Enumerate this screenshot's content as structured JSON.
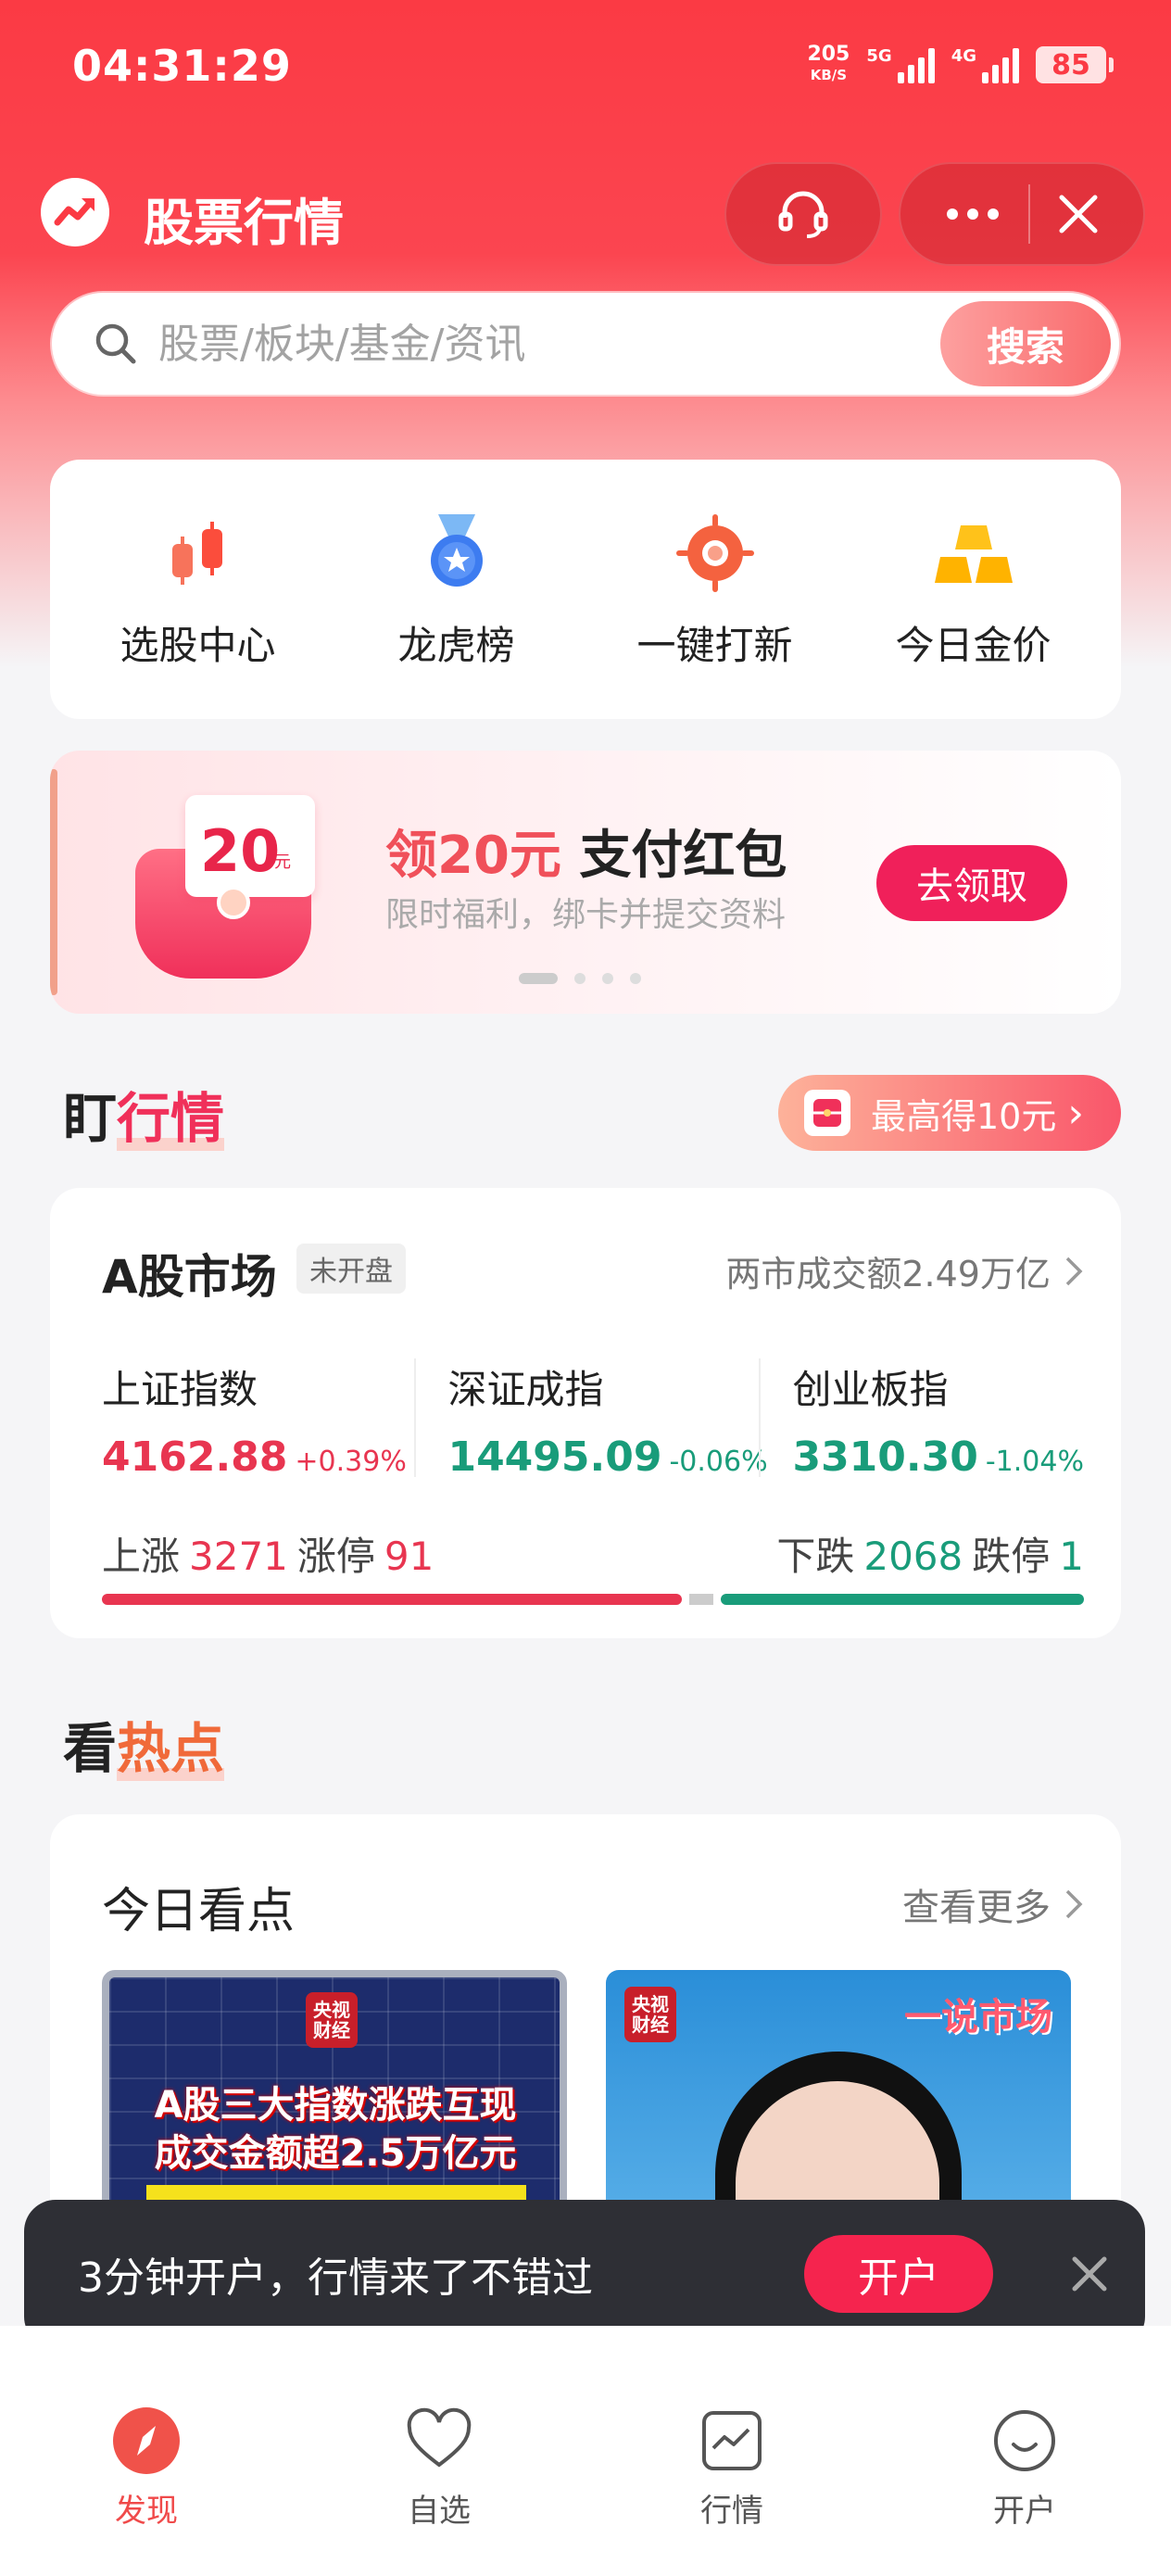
{
  "status_bar": {
    "time": "04:31:29",
    "net_speed_value": "205",
    "net_speed_unit": "KB/S",
    "signal1_label": "5G",
    "signal2_label": "4G",
    "battery": "85"
  },
  "header": {
    "title": "股票行情",
    "support_icon": "headset-icon",
    "more_icon": "more-dots-icon",
    "close_icon": "close-icon"
  },
  "search": {
    "placeholder": "股票/板块/基金/资讯",
    "button": "搜索"
  },
  "quick_links": [
    {
      "label": "选股中心",
      "icon": "candlestick-icon"
    },
    {
      "label": "龙虎榜",
      "icon": "medal-icon"
    },
    {
      "label": "一键打新",
      "icon": "target-icon"
    },
    {
      "label": "今日金价",
      "icon": "gold-bars-icon"
    }
  ],
  "banner": {
    "coupon_amount": "20",
    "coupon_unit": "元",
    "headline_amount": "领20元",
    "headline_rest": " 支付红包",
    "subtitle": "限时福利，绑卡并提交资料",
    "button": "去领取",
    "page_count": 4,
    "active_page": 1
  },
  "market_section": {
    "title_plain": "盯",
    "title_highlight": "行情",
    "reward_label": "最高得10元",
    "reward_chevron": "›"
  },
  "market_card": {
    "title": "A股市场",
    "status_badge": "未开盘",
    "turnover": "两市成交额2.49万亿",
    "indices": [
      {
        "name": "上证指数",
        "value": "4162.88",
        "change": "+0.39%",
        "direction": "up"
      },
      {
        "name": "深证成指",
        "value": "14495.09",
        "change": "-0.06%",
        "direction": "down"
      },
      {
        "name": "创业板指",
        "value": "3310.30",
        "change": "-1.04%",
        "direction": "down"
      }
    ],
    "breadth": {
      "up_label": "上涨",
      "up_count": "3271",
      "limit_up_label": "涨停",
      "limit_up_count": "91",
      "down_label": "下跌",
      "down_count": "2068",
      "limit_down_label": "跌停",
      "limit_down_count": "1"
    },
    "breadth_bar": {
      "up_share": 0.6,
      "flat_share": 0.025,
      "down_share": 0.375
    },
    "colors": {
      "up": "#e83550",
      "down": "#199c7a",
      "flat": "#cccccc"
    }
  },
  "hot_section": {
    "title_plain": "看",
    "title_highlight": "热点"
  },
  "hot_card": {
    "title": "今日看点",
    "more": "查看更多",
    "items": [
      {
        "headline_line1": "A股三大指数涨跌互现",
        "headline_line2": "成交金额超2.5万亿元",
        "seal": "央视财经"
      },
      {
        "seal": "央视财经",
        "brand": "一说市场"
      }
    ]
  },
  "toast": {
    "text": "3分钟开户，行情来了不错过",
    "button": "开户",
    "close_icon": "close-icon"
  },
  "tabbar": [
    {
      "label": "发现",
      "icon": "compass-icon",
      "active": true
    },
    {
      "label": "自选",
      "icon": "heart-icon",
      "active": false
    },
    {
      "label": "行情",
      "icon": "chart-icon",
      "active": false
    },
    {
      "label": "开户",
      "icon": "smile-icon",
      "active": false
    }
  ],
  "theme": {
    "brand_red": "#fb3a44",
    "accent_pink": "#f0205a"
  }
}
